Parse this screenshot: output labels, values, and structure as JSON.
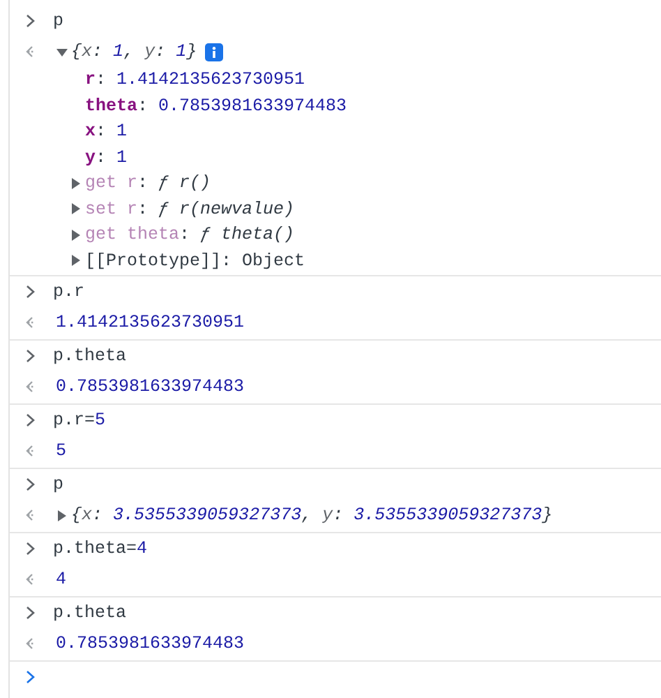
{
  "entries": [
    {
      "input": [
        {
          "text": "p",
          "kind": "code"
        }
      ],
      "result": {
        "kind": "object",
        "expanded": true,
        "info": true,
        "preview": [
          {
            "text": "{",
            "kind": "punct"
          },
          {
            "text": "x",
            "kind": "pkey"
          },
          {
            "text": ": ",
            "kind": "punct"
          },
          {
            "text": "1",
            "kind": "number"
          },
          {
            "text": ", ",
            "kind": "punct"
          },
          {
            "text": "y",
            "kind": "pkey"
          },
          {
            "text": ": ",
            "kind": "punct"
          },
          {
            "text": "1",
            "kind": "number"
          },
          {
            "text": "}",
            "kind": "punct"
          }
        ],
        "properties": [
          {
            "kind": "field",
            "tokens": [
              {
                "text": "r",
                "kind": "key"
              },
              {
                "text": ": ",
                "kind": "code"
              },
              {
                "text": "1.4142135623730951",
                "kind": "number"
              }
            ]
          },
          {
            "kind": "field",
            "tokens": [
              {
                "text": "theta",
                "kind": "key"
              },
              {
                "text": ": ",
                "kind": "code"
              },
              {
                "text": "0.7853981633974483",
                "kind": "number"
              }
            ]
          },
          {
            "kind": "field",
            "tokens": [
              {
                "text": "x",
                "kind": "key"
              },
              {
                "text": ": ",
                "kind": "code"
              },
              {
                "text": "1",
                "kind": "number"
              }
            ]
          },
          {
            "kind": "field",
            "tokens": [
              {
                "text": "y",
                "kind": "key"
              },
              {
                "text": ": ",
                "kind": "code"
              },
              {
                "text": "1",
                "kind": "number"
              }
            ]
          },
          {
            "kind": "accessor",
            "expanded": false,
            "tokens": [
              {
                "text": "get r",
                "kind": "akey"
              },
              {
                "text": ": ",
                "kind": "code"
              },
              {
                "text": "ƒ",
                "kind": "func"
              },
              {
                "text": " r()",
                "kind": "italic"
              }
            ]
          },
          {
            "kind": "accessor",
            "expanded": false,
            "tokens": [
              {
                "text": "set r",
                "kind": "akey"
              },
              {
                "text": ": ",
                "kind": "code"
              },
              {
                "text": "ƒ",
                "kind": "func"
              },
              {
                "text": " r(newvalue)",
                "kind": "italic"
              }
            ]
          },
          {
            "kind": "accessor",
            "expanded": false,
            "tokens": [
              {
                "text": "get theta",
                "kind": "akey"
              },
              {
                "text": ": ",
                "kind": "code"
              },
              {
                "text": "ƒ",
                "kind": "func"
              },
              {
                "text": " theta()",
                "kind": "italic"
              }
            ]
          },
          {
            "kind": "accessor",
            "expanded": false,
            "tokens": [
              {
                "text": "[[Prototype]]",
                "kind": "code"
              },
              {
                "text": ": Object",
                "kind": "code"
              }
            ]
          }
        ]
      }
    },
    {
      "input": [
        {
          "text": "p.r",
          "kind": "code"
        }
      ],
      "result": {
        "kind": "value",
        "tokens": [
          {
            "text": "1.4142135623730951",
            "kind": "number"
          }
        ]
      }
    },
    {
      "input": [
        {
          "text": "p.theta",
          "kind": "code"
        }
      ],
      "result": {
        "kind": "value",
        "tokens": [
          {
            "text": "0.7853981633974483",
            "kind": "number"
          }
        ]
      }
    },
    {
      "input": [
        {
          "text": "p.r=",
          "kind": "code"
        },
        {
          "text": "5",
          "kind": "number"
        }
      ],
      "result": {
        "kind": "value",
        "tokens": [
          {
            "text": "5",
            "kind": "number"
          }
        ]
      }
    },
    {
      "input": [
        {
          "text": "p",
          "kind": "code"
        }
      ],
      "result": {
        "kind": "object",
        "expanded": false,
        "info": false,
        "preview": [
          {
            "text": "{",
            "kind": "punct"
          },
          {
            "text": "x",
            "kind": "pkey"
          },
          {
            "text": ": ",
            "kind": "punct"
          },
          {
            "text": "3.5355339059327373",
            "kind": "number"
          },
          {
            "text": ", ",
            "kind": "punct"
          },
          {
            "text": "y",
            "kind": "pkey"
          },
          {
            "text": ": ",
            "kind": "punct"
          },
          {
            "text": "3.5355339059327373",
            "kind": "number"
          },
          {
            "text": "}",
            "kind": "punct"
          }
        ]
      }
    },
    {
      "input": [
        {
          "text": "p.theta=",
          "kind": "code"
        },
        {
          "text": "4",
          "kind": "number"
        }
      ],
      "result": {
        "kind": "value",
        "tokens": [
          {
            "text": "4",
            "kind": "number"
          }
        ]
      }
    },
    {
      "input": [
        {
          "text": "p.theta",
          "kind": "code"
        }
      ],
      "result": {
        "kind": "value",
        "tokens": [
          {
            "text": "0.7853981633974483",
            "kind": "number"
          }
        ]
      }
    }
  ],
  "prompt": {
    "active": true
  }
}
